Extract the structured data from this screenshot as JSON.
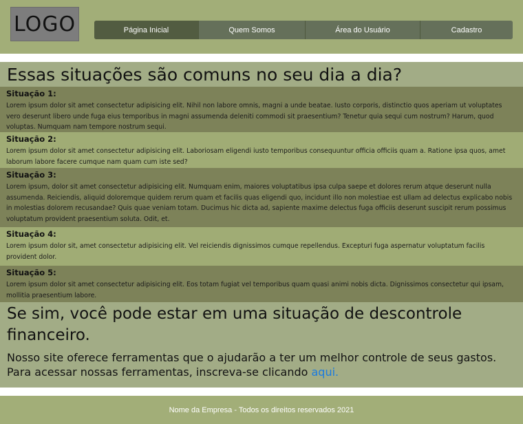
{
  "header": {
    "logo_text": "LOGO",
    "nav": [
      {
        "label": "Página Inicial"
      },
      {
        "label": "Quem Somos"
      },
      {
        "label": "Área do Usuário"
      },
      {
        "label": "Cadastro"
      }
    ]
  },
  "main": {
    "title": "Essas situações são comuns no seu dia a dia?",
    "situations": [
      {
        "title": "Situação 1:",
        "text": "Lorem ipsum dolor sit amet consectetur adipisicing elit. Nihil non labore omnis, magni a unde beatae. Iusto corporis, distinctio quos aperiam ut voluptates vero deserunt libero unde fuga eius temporibus in magni assumenda deleniti commodi sit praesentium? Tenetur quia sequi cum nostrum? Harum, quod voluptas. Numquam nam tempore nostrum sequi."
      },
      {
        "title": "Situação 2:",
        "text": "Lorem ipsum dolor sit amet consectetur adipisicing elit. Laboriosam eligendi iusto temporibus consequuntur officia officiis quam a. Ratione ipsa quos, amet laborum labore facere cumque nam quam cum iste sed?"
      },
      {
        "title": "Situação 3:",
        "text": "Lorem ipsum, dolor sit amet consectetur adipisicing elit. Numquam enim, maiores voluptatibus ipsa culpa saepe et dolores rerum atque deserunt nulla assumenda. Reiciendis, aliquid doloremque quidem rerum quam et facilis quas eligendi quo, incidunt illo non molestiae est ullam ad delectus explicabo nobis in molestias dolorem recusandae? Quis quae veniam totam. Ducimus hic dicta ad, sapiente maxime delectus fuga officiis deserunt suscipit rerum possimus voluptatum provident praesentium soluta. Odit, et."
      },
      {
        "title": "Situação 4:",
        "text": "Lorem ipsum dolor sit, amet consectetur adipisicing elit. Vel reiciendis dignissimos cumque repellendus. Excepturi fuga aspernatur voluptatum facilis provident dolor."
      },
      {
        "title": "Situação 5:",
        "text": "Lorem ipsum dolor sit amet consectetur adipisicing elit. Eos totam fugiat vel temporibus quam quasi animi nobis dicta. Dignissimos consectetur qui ipsam, mollitia praesentium labore."
      }
    ],
    "conclusion_title": "Se sim, você pode estar em uma situação de descontrole financeiro.",
    "conclusion_text": "Nosso site oferece ferramentas que o ajudarão a ter um melhor controle de seus gastos. Para acessar nossas ferramentas, inscreva-se clicando",
    "conclusion_link": "aqui."
  },
  "footer": {
    "text": "Nome da Empresa - Todos os direitos reservados 2021"
  },
  "colors": {
    "header_bg": "#a2ae78",
    "nav_bg": "#5f6a4c",
    "main_bg": "#a2ac86",
    "situation_dark": "#7d8259",
    "situation_light": "#a0ac75",
    "link": "#1a7be0"
  }
}
